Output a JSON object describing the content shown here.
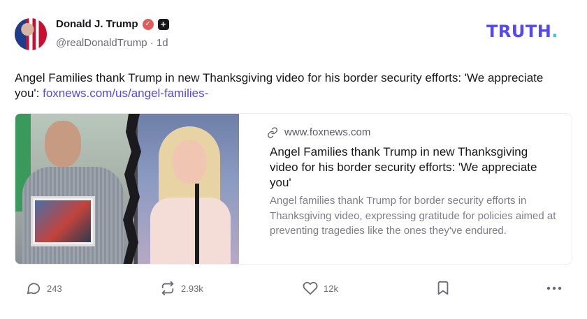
{
  "author": {
    "name": "Donald J. Trump",
    "handle": "@realDonaldTrump",
    "time": "1d",
    "verified_icon": "verified-badge-icon",
    "badge_icon": "plus-badge-icon"
  },
  "logo": {
    "text": "TRUTH",
    "dot": ".",
    "brand_color": "#5448ee",
    "dot_color": "#3fc5c1"
  },
  "post": {
    "text": "Angel Families thank Trump in new Thanksgiving video for his border security efforts: 'We appreciate you': ",
    "link_text": "foxnews.com/us/angel-families-"
  },
  "card": {
    "domain": "www.foxnews.com",
    "title": "Angel Families thank Trump in new Thanksgiving video for his border security efforts: 'We appreciate you'",
    "description": "Angel families thank Trump for border security efforts in Thanksgiving video, expressing gratitude for policies aimed at preventing tragedies like the ones they've endured."
  },
  "actions": {
    "replies": "243",
    "retruths": "2.93k",
    "likes": "12k"
  }
}
